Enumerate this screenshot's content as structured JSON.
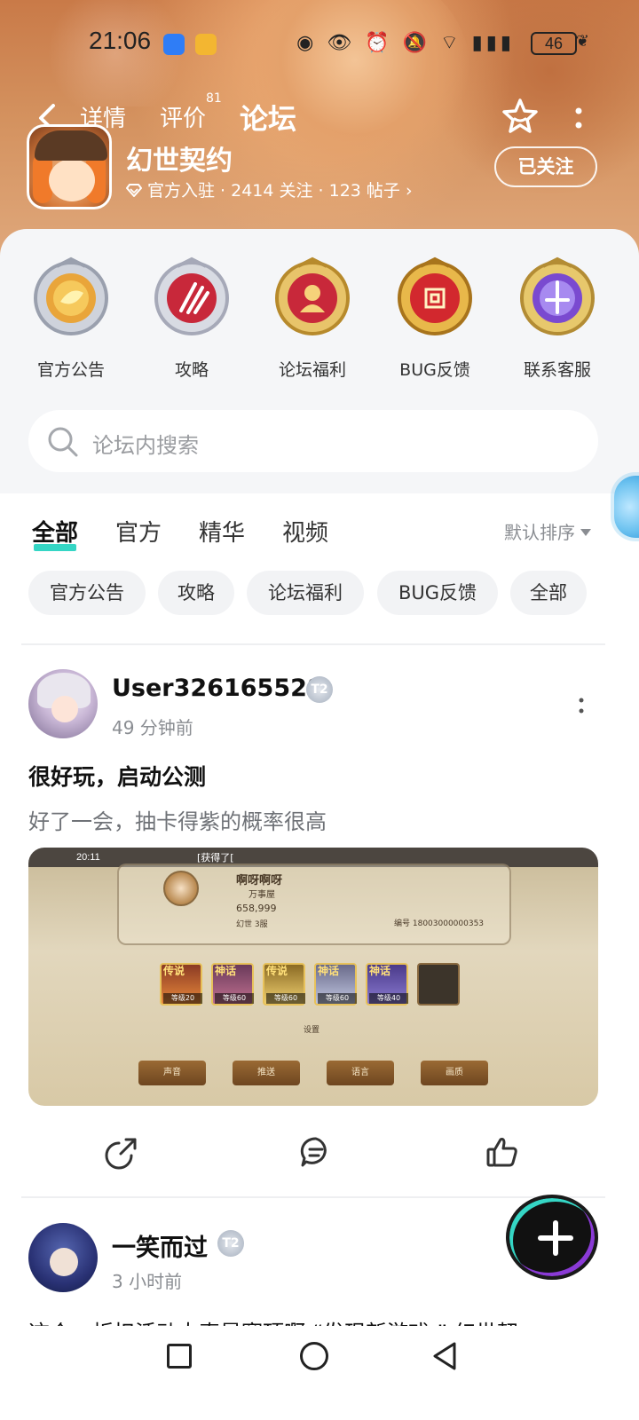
{
  "statusbar": {
    "time": "21:06",
    "battery": "46"
  },
  "header": {
    "tabs": {
      "detail": "详情",
      "review": "评价",
      "review_count": "81",
      "forum": "论坛"
    },
    "game_name": "幻世契约",
    "meta": "官方入驻 · 2414 关注 · 123 帖子",
    "follow_label": "已关注"
  },
  "categories": [
    {
      "label": "官方公告"
    },
    {
      "label": "攻略"
    },
    {
      "label": "论坛福利"
    },
    {
      "label": "BUG反馈"
    },
    {
      "label": "联系客服"
    }
  ],
  "search": {
    "placeholder": "论坛内搜索"
  },
  "filters": {
    "tabs": [
      "全部",
      "官方",
      "精华",
      "视频"
    ],
    "sort_label": "默认排序"
  },
  "chips": [
    "官方公告",
    "攻略",
    "论坛福利",
    "BUG反馈",
    "全部"
  ],
  "posts": [
    {
      "username": "User326165528",
      "level": "T2",
      "time": "49 分钟前",
      "title": "很好玩，启动公测",
      "body": "好了一会，抽卡得紫的概率很高",
      "screenshot": {
        "time": "20:11",
        "message": "[获得了[",
        "player_name": "啊呀啊呀",
        "guild": "万事屋",
        "power": "658,999",
        "realm": "幻世 3服",
        "id": "编号 18003000000353",
        "hero_tags": [
          "传说",
          "神话",
          "传说",
          "神话",
          "神话"
        ],
        "hero_levels": [
          "等级20",
          "等级60",
          "等级60",
          "等级60",
          "等级40"
        ],
        "settings_label": "设置",
        "buttons": [
          "声音",
          "推送",
          "语言",
          "画质"
        ]
      }
    },
    {
      "username": "一笑而过",
      "level": "T2",
      "time": "3 小时前",
      "title_peek": "这个一折扣活动太真是赛顶啊 “发现新游戏 ” 幻世契"
    }
  ]
}
